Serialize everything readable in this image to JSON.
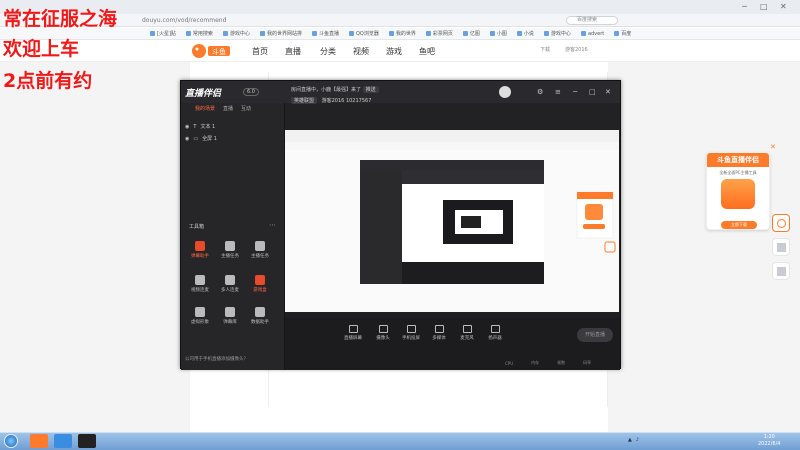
{
  "overlay": {
    "line1": "常在征服之海",
    "line2": "欢迎上车",
    "line3": "2点前有约"
  },
  "browser": {
    "url": "douyu.com/vod/recommend",
    "search_placeholder": "百度搜索",
    "bookmarks": [
      "[火星]贴",
      "常用搜索",
      "游戏中心",
      "我的世界网站排",
      "斗鱼直播",
      "QQ浏览器",
      "我的世界",
      "彩票网页",
      "亿图",
      "小图",
      "小说",
      "游戏中心",
      "advert",
      "百度"
    ]
  },
  "site": {
    "logo_text": "斗鱼",
    "nav": [
      "首页",
      "直播",
      "分类",
      "视频",
      "游戏",
      "鱼吧"
    ],
    "user_label": "下载",
    "user_name": "游客2016"
  },
  "app": {
    "title": "直播伴侣",
    "badge": "6.0",
    "side_tabs": [
      "我的场景",
      "直播",
      "互动"
    ],
    "scenes": [
      "文本 1",
      "全屏 1"
    ],
    "tools_title": "工具箱",
    "tools": [
      {
        "label": "弹幕助手",
        "active": true
      },
      {
        "label": "主播任务",
        "active": false
      },
      {
        "label": "主播任务",
        "active": false
      },
      {
        "label": "视频连麦",
        "active": false
      },
      {
        "label": "多人连麦",
        "active": false
      },
      {
        "label": "游戏盒",
        "active": true
      },
      {
        "label": "虚拟形象",
        "active": false
      },
      {
        "label": "弹幕库",
        "active": false
      },
      {
        "label": "数据助手",
        "active": false
      }
    ],
    "info_line1": "房间直播中，小鹿【最强】来了",
    "info_chip": "推送",
    "info_line2_tag": "英雄联盟",
    "info_line2_name": "游客2016",
    "info_line2_num": "10217567",
    "bottom_items": [
      "直播屏幕",
      "摄像头",
      "手机投屏",
      "多媒体",
      "麦克风",
      "扬声器"
    ],
    "start_label": "开始直播",
    "side_bottom": "公司用于手机直播添加摄像头？",
    "status": [
      "CPU",
      "内存",
      "帧数",
      "码率"
    ]
  },
  "promo": {
    "head": "斗鱼直播伴侣",
    "sub": "全新全面PC主播工具",
    "button": "立即下载"
  },
  "taskbar": {
    "time": "1:20",
    "date": "2022/6/4"
  }
}
